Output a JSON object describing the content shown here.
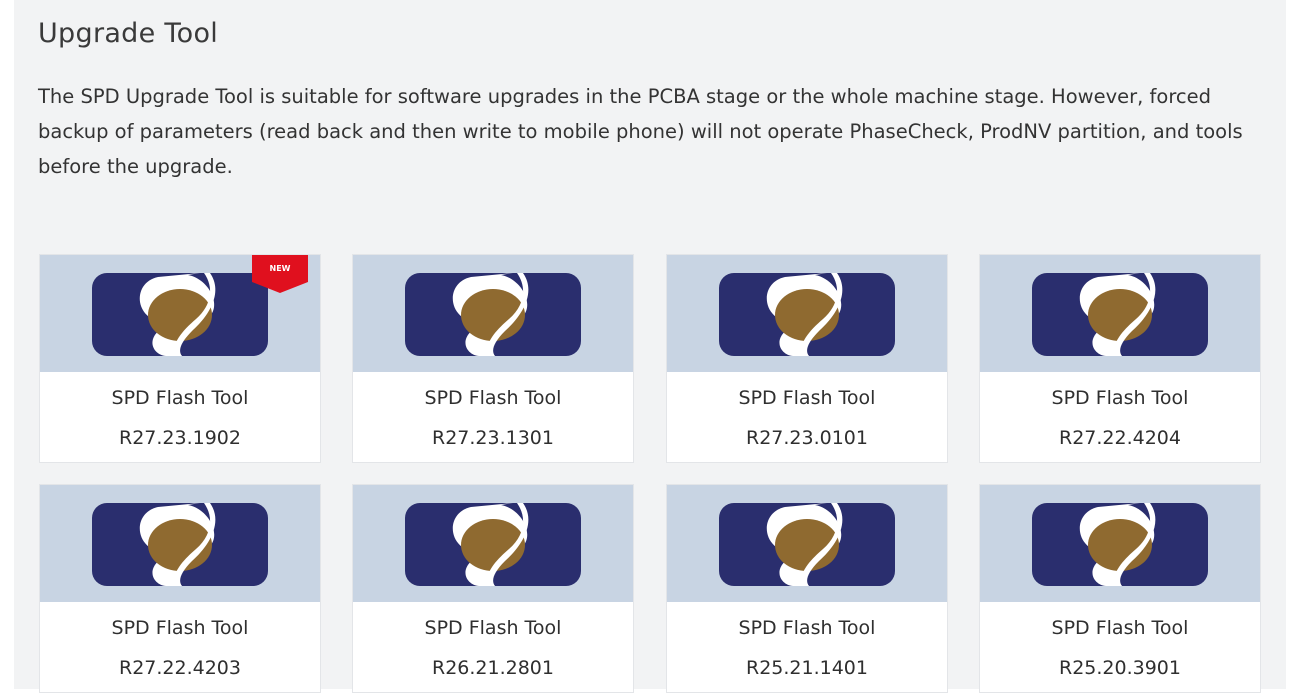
{
  "page": {
    "title": "Upgrade Tool",
    "description": "The SPD Upgrade Tool is suitable for software upgrades in the PCBA stage or the whole machine stage. However, forced backup of parameters (read back and then write to mobile phone) will not operate PhaseCheck, ProdNV partition, and tools before the upgrade."
  },
  "colors": {
    "panel_background": "#f2f3f4",
    "thumb_background": "#c8d4e3",
    "logo_navy": "#2a2e6e",
    "logo_gold": "#8f6a30",
    "badge_red": "#e0101e"
  },
  "tools": [
    {
      "name": "SPD Flash Tool",
      "version": "R27.23.1902",
      "badge": "NEW",
      "icon": "spd-logo-icon"
    },
    {
      "name": "SPD Flash Tool",
      "version": "R27.23.1301",
      "badge": "",
      "icon": "spd-logo-icon"
    },
    {
      "name": "SPD Flash Tool",
      "version": "R27.23.0101",
      "badge": "",
      "icon": "spd-logo-icon"
    },
    {
      "name": "SPD Flash Tool",
      "version": "R27.22.4204",
      "badge": "",
      "icon": "spd-logo-icon"
    },
    {
      "name": "SPD Flash Tool",
      "version": "R27.22.4203",
      "badge": "",
      "icon": "spd-logo-icon"
    },
    {
      "name": "SPD Flash Tool",
      "version": "R26.21.2801",
      "badge": "",
      "icon": "spd-logo-icon"
    },
    {
      "name": "SPD Flash Tool",
      "version": "R25.21.1401",
      "badge": "",
      "icon": "spd-logo-icon"
    },
    {
      "name": "SPD Flash Tool",
      "version": "R25.20.3901",
      "badge": "",
      "icon": "spd-logo-icon"
    }
  ]
}
